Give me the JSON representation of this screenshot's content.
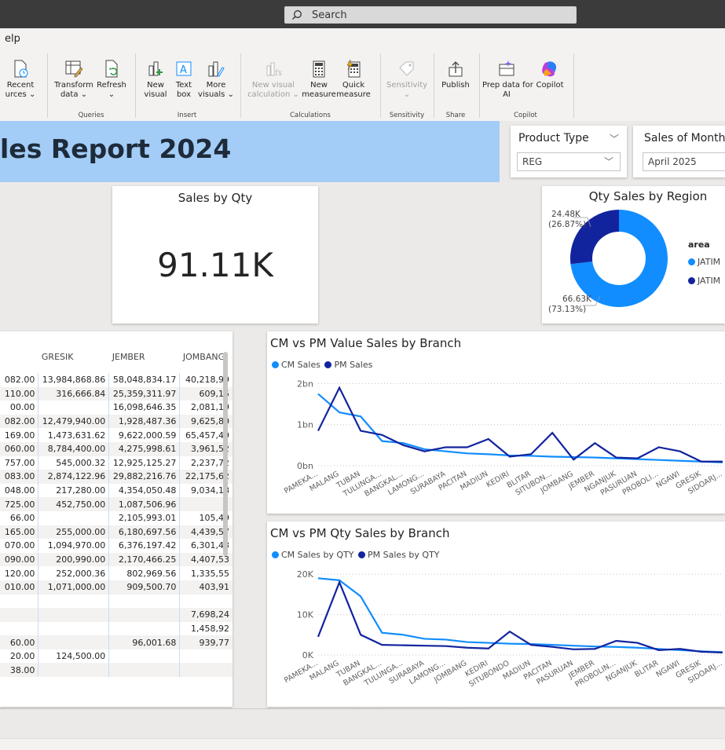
{
  "search": {
    "label": "Search"
  },
  "menu": {
    "help": "elp"
  },
  "ribbon": {
    "buttons": {
      "recent": "Recent\nurces ⌄",
      "transform": "Transform\ndata ⌄",
      "refresh": "Refresh\n⌄",
      "new_visual": "New\nvisual",
      "text_box": "Text\nbox",
      "more_visuals": "More\nvisuals ⌄",
      "new_visual_calc": "New visual\ncalculation ⌄",
      "new_measure": "New\nmeasure",
      "quick_measure": "Quick\nmeasure",
      "sensitivity": "Sensitivity\n⌄",
      "publish": "Publish",
      "prep_data": "Prep data for\nAI",
      "copilot": "Copilot"
    },
    "groups": {
      "queries": "Queries",
      "insert": "Insert",
      "calculations": "Calculations",
      "sensitivity": "Sensitivity",
      "share": "Share",
      "copilot": "Copilot"
    }
  },
  "report": {
    "title": "les Report 2024",
    "accent": "#a3cdf7"
  },
  "slicers": {
    "product_type": {
      "label": "Product Type",
      "value": "REG"
    },
    "sales_month": {
      "label": "Sales of Month",
      "value": "April 2025"
    }
  },
  "kpi": {
    "title": "Sales by Qty",
    "value": "91.11K"
  },
  "donut": {
    "title": "Qty Sales by Region",
    "legend_title": "area",
    "legend_items": [
      "JATIM",
      "JATIM"
    ],
    "slices": [
      {
        "label": "66.63K",
        "pct": "(73.13%)",
        "value": 66.63,
        "color": "#118dff"
      },
      {
        "label": "24.48K",
        "pct": "(26.87%)",
        "value": 24.48,
        "color": "#12239e"
      }
    ]
  },
  "matrix": {
    "headers": [
      "",
      "GRESIK",
      "JEMBER",
      "JOMBANG"
    ],
    "rows": [
      [
        "082.00",
        "13,984,868.86",
        "58,048,834.17",
        "40,218,99"
      ],
      [
        "110.00",
        "316,666.84",
        "25,359,311.97",
        "609,15"
      ],
      [
        "00.00",
        "",
        "16,098,646.35",
        "2,081,19"
      ],
      [
        "082.00",
        "12,479,940.00",
        "1,928,487.36",
        "9,625,80"
      ],
      [
        "169.00",
        "1,473,631.62",
        "9,622,000.59",
        "65,457,49"
      ],
      [
        "060.00",
        "8,784,400.00",
        "4,275,998.61",
        "3,961,52"
      ],
      [
        "757.00",
        "545,000.32",
        "12,925,125.27",
        "2,237,72"
      ],
      [
        "083.00",
        "2,874,122.96",
        "29,882,216.76",
        "22,175,62"
      ],
      [
        "048.00",
        "217,280.00",
        "4,354,050.48",
        "9,034,18"
      ],
      [
        "725.00",
        "452,750.00",
        "1,087,506.96",
        ""
      ],
      [
        "66.00",
        "",
        "2,105,993.01",
        "105,49"
      ],
      [
        "165.00",
        "255,000.00",
        "6,180,697.56",
        "4,439,57"
      ],
      [
        "070.00",
        "1,094,970.00",
        "6,376,197.42",
        "6,301,43"
      ],
      [
        "090.00",
        "200,990.00",
        "2,170,466.25",
        "4,407,53"
      ],
      [
        "120.00",
        "252,000.36",
        "802,969.56",
        "1,335,55"
      ],
      [
        "010.00",
        "1,071,000.00",
        "909,500.70",
        "403,91"
      ],
      [
        "",
        "",
        "",
        ""
      ],
      [
        "",
        "",
        "",
        "7,698,24"
      ],
      [
        "",
        "",
        "",
        "1,458,92"
      ],
      [
        "60.00",
        "",
        "96,001.68",
        "939,77"
      ],
      [
        "20.00",
        "124,500.00",
        "",
        ""
      ],
      [
        "38.00",
        "",
        "",
        ""
      ]
    ]
  },
  "chart_data": [
    {
      "type": "line",
      "title": "CM vs PM Value Sales by Branch",
      "categories": [
        "PAMEKA...",
        "MALANG",
        "TUBAN",
        "TULUNGA...",
        "BANGKAL...",
        "LAMONG...",
        "SURABAYA",
        "PACITAN",
        "MADIUN",
        "KEDIRI",
        "BLITAR",
        "SITUBON...",
        "JOMBANG",
        "JEMBER",
        "NGANJUK",
        "PASURUAN",
        "PROBOLI...",
        "NGAWI",
        "GRESIK",
        "SIDOARJ..."
      ],
      "ylim": [
        0,
        2.2
      ],
      "yticks": [
        "0bn",
        "1bn",
        "2bn"
      ],
      "series": [
        {
          "name": "CM Sales",
          "color": "#118dff",
          "values": [
            1.75,
            1.3,
            1.2,
            0.6,
            0.55,
            0.4,
            0.35,
            0.3,
            0.28,
            0.25,
            0.24,
            0.22,
            0.21,
            0.2,
            0.18,
            0.16,
            0.14,
            0.12,
            0.1,
            0.08
          ]
        },
        {
          "name": "PM Sales",
          "color": "#12239e",
          "values": [
            0.85,
            1.9,
            0.85,
            0.75,
            0.5,
            0.35,
            0.45,
            0.45,
            0.65,
            0.22,
            0.28,
            0.8,
            0.15,
            0.55,
            0.2,
            0.18,
            0.45,
            0.35,
            0.1,
            0.1
          ]
        }
      ]
    },
    {
      "type": "line",
      "title": "CM vs PM Qty Sales by Branch",
      "categories": [
        "PAMEKA...",
        "MALANG",
        "TUBAN",
        "BANGKAL...",
        "TULUNGA...",
        "SURABAYA",
        "LAMONG...",
        "JOMBANG",
        "KEDIRI",
        "SITUBONDO",
        "MADIUN",
        "PACITAN",
        "PASURUAN",
        "JEMBER",
        "PROBOLIN...",
        "NGANJUK",
        "BLITAR",
        "NGAWI",
        "GRESIK",
        "SIDOARJ..."
      ],
      "ylim": [
        0,
        21000
      ],
      "yticks": [
        "0K",
        "10K",
        "20K"
      ],
      "series": [
        {
          "name": "CM Sales by QTY",
          "color": "#118dff",
          "values": [
            19000,
            18500,
            14500,
            5500,
            5000,
            4000,
            3800,
            3200,
            3000,
            2800,
            2700,
            2500,
            2300,
            2100,
            2000,
            1800,
            1500,
            1200,
            900,
            700
          ]
        },
        {
          "name": "PM Sales by QTY",
          "color": "#12239e",
          "values": [
            4500,
            18000,
            5000,
            2500,
            2400,
            2300,
            2200,
            1800,
            1600,
            5800,
            2500,
            2000,
            1400,
            1500,
            3500,
            3000,
            1200,
            1500,
            800,
            600
          ]
        }
      ]
    }
  ]
}
